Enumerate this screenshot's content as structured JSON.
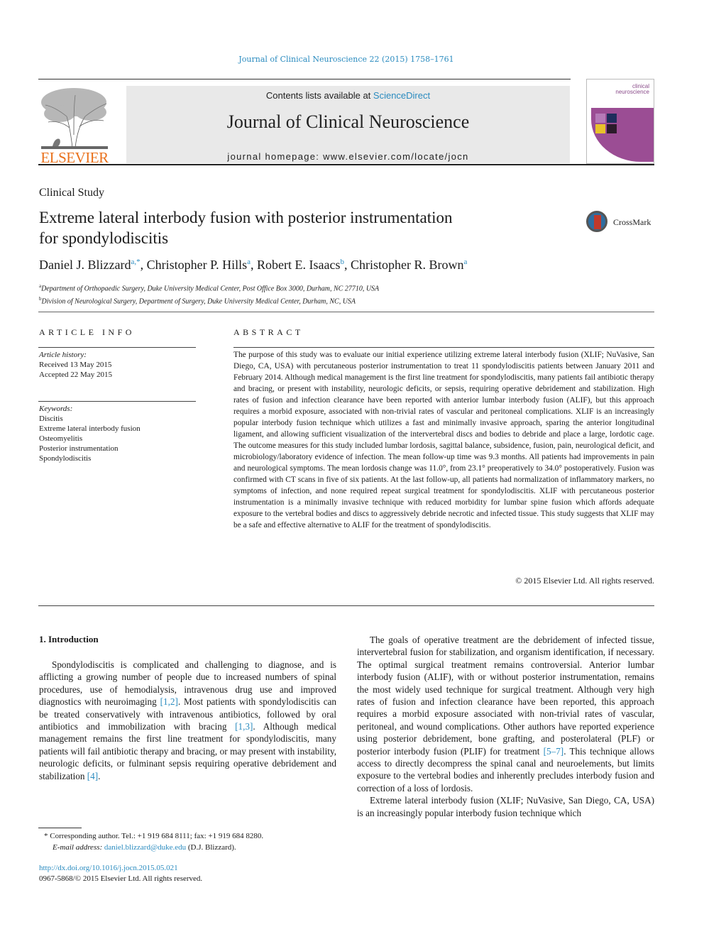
{
  "header": {
    "journal_ref": "Journal of Clinical Neuroscience 22 (2015) 1758–1761",
    "publisher_logo_text": "ELSEVIER",
    "contents_prefix": "Contents lists available at ",
    "contents_link": "ScienceDirect",
    "journal_title": "Journal of Clinical Neuroscience",
    "homepage": "journal homepage: www.elsevier.com/locate/jocn",
    "cover_title_line1": "clinical",
    "cover_title_line2": "neuroscience"
  },
  "article": {
    "section_type": "Clinical Study",
    "title_line1": "Extreme lateral interbody fusion with posterior instrumentation",
    "title_line2": "for spondylodiscitis",
    "crossmark_label": "CrossMark",
    "authors": [
      {
        "name": "Daniel J. Blizzard",
        "sup": "a,*"
      },
      {
        "name": "Christopher P. Hills",
        "sup": "a"
      },
      {
        "name": "Robert E. Isaacs",
        "sup": "b"
      },
      {
        "name": "Christopher R. Brown",
        "sup": "a"
      }
    ],
    "affiliations": [
      {
        "key": "a",
        "text": "Department of Orthopaedic Surgery, Duke University Medical Center, Post Office Box 3000, Durham, NC 27710, USA"
      },
      {
        "key": "b",
        "text": "Division of Neurological Surgery, Department of Surgery, Duke University Medical Center, Durham, NC, USA"
      }
    ]
  },
  "article_info": {
    "heading": "ARTICLE INFO",
    "history_label": "Article history:",
    "received": "Received 13 May 2015",
    "accepted": "Accepted 22 May 2015",
    "keywords_label": "Keywords:",
    "keywords": [
      "Discitis",
      "Extreme lateral interbody fusion",
      "Osteomyelitis",
      "Posterior instrumentation",
      "Spondylodiscitis"
    ]
  },
  "abstract": {
    "heading": "ABSTRACT",
    "text": "The purpose of this study was to evaluate our initial experience utilizing extreme lateral interbody fusion (XLIF; NuVasive, San Diego, CA, USA) with percutaneous posterior instrumentation to treat 11 spondylodiscitis patients between January 2011 and February 2014. Although medical management is the first line treatment for spondylodiscitis, many patients fail antibiotic therapy and bracing, or present with instability, neurologic deficits, or sepsis, requiring operative debridement and stabilization. High rates of fusion and infection clearance have been reported with anterior lumbar interbody fusion (ALIF), but this approach requires a morbid exposure, associated with non-trivial rates of vascular and peritoneal complications. XLIF is an increasingly popular interbody fusion technique which utilizes a fast and minimally invasive approach, sparing the anterior longitudinal ligament, and allowing sufficient visualization of the intervertebral discs and bodies to debride and place a large, lordotic cage. The outcome measures for this study included lumbar lordosis, sagittal balance, subsidence, fusion, pain, neurological deficit, and microbiology/laboratory evidence of infection. The mean follow-up time was 9.3 months. All patients had improvements in pain and neurological symptoms. The mean lordosis change was 11.0°, from 23.1° preoperatively to 34.0° postoperatively. Fusion was confirmed with CT scans in five of six patients. At the last follow-up, all patients had normalization of inflammatory markers, no symptoms of infection, and none required repeat surgical treatment for spondylodiscitis. XLIF with percutaneous posterior instrumentation is a minimally invasive technique with reduced morbidity for lumbar spine fusion which affords adequate exposure to the vertebral bodies and discs to aggressively debride necrotic and infected tissue. This study suggests that XLIF may be a safe and effective alternative to ALIF for the treatment of spondylodiscitis.",
    "copyright": "© 2015 Elsevier Ltd. All rights reserved."
  },
  "body": {
    "intro_heading": "1. Introduction",
    "left_p1_a": "Spondylodiscitis is complicated and challenging to diagnose, and is afflicting a growing number of people due to increased numbers of spinal procedures, use of hemodialysis, intravenous drug use and improved diagnostics with neuroimaging ",
    "left_p1_ref1": "[1,2]",
    "left_p1_b": ". Most patients with spondylodiscitis can be treated conservatively with intravenous antibiotics, followed by oral antibiotics and immobilization with bracing ",
    "left_p1_ref2": "[1,3]",
    "left_p1_c": ". Although medical management remains the first line treatment for spondylodiscitis, many patients will fail antibiotic therapy and bracing, or may present with instability, neurologic deficits, or fulminant sepsis requiring operative debridement and stabilization ",
    "left_p1_ref3": "[4]",
    "left_p1_d": ".",
    "right_p1_a": "The goals of operative treatment are the debridement of infected tissue, intervertebral fusion for stabilization, and organism identification, if necessary. The optimal surgical treatment remains controversial. Anterior lumbar interbody fusion (ALIF), with or without posterior instrumentation, remains the most widely used technique for surgical treatment. Although very high rates of fusion and infection clearance have been reported, this approach requires a morbid exposure associated with non-trivial rates of vascular, peritoneal, and wound complications. Other authors have reported experience using posterior debridement, bone grafting, and posterolateral (PLF) or posterior interbody fusion (PLIF) for treatment ",
    "right_p1_ref": "[5–7]",
    "right_p1_b": ". This technique allows access to directly decompress the spinal canal and neuroelements, but limits exposure to the vertebral bodies and inherently precludes interbody fusion and correction of a loss of lordosis.",
    "right_p2": "Extreme lateral interbody fusion (XLIF; NuVasive, San Diego, CA, USA) is an increasingly popular interbody fusion technique which"
  },
  "footer": {
    "footnote_line1": "* Corresponding author. Tel.: +1 919 684 8111; fax: +1 919 684 8280.",
    "email_label": "E-mail address: ",
    "email": "daniel.blizzard@duke.edu",
    "email_suffix": " (D.J. Blizzard).",
    "doi": "http://dx.doi.org/10.1016/j.jocn.2015.05.021",
    "issn": "0967-5868/© 2015 Elsevier Ltd. All rights reserved."
  }
}
